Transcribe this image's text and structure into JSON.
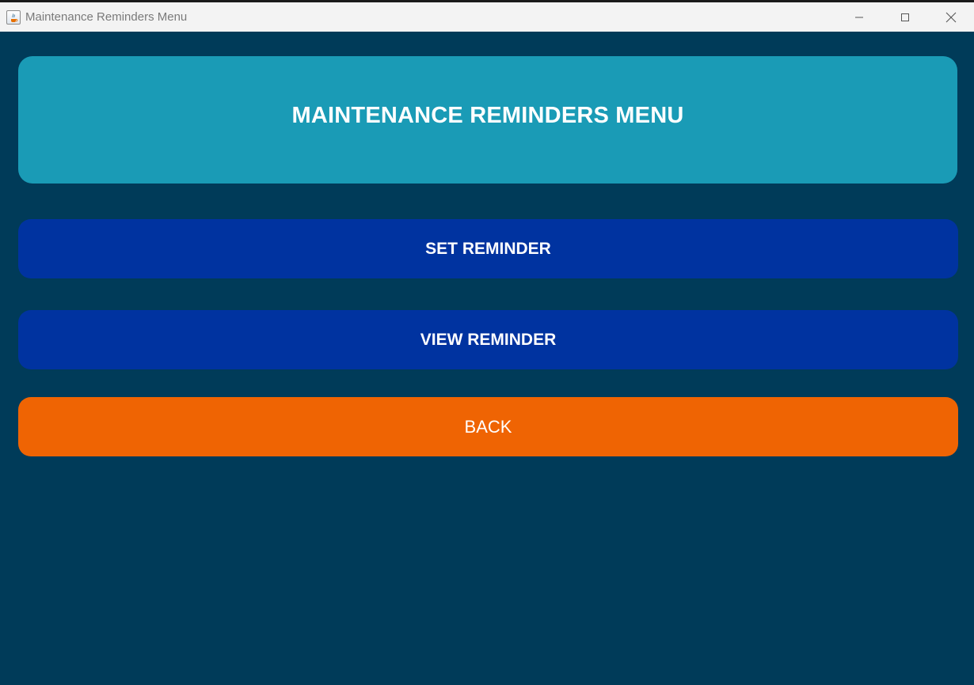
{
  "window": {
    "title": "Maintenance Reminders Menu",
    "app_icon": "java-icon",
    "controls": [
      "minimize-icon",
      "maximize-icon",
      "close-icon"
    ]
  },
  "header": {
    "title": "MAINTENANCE REMINDERS MENU"
  },
  "menu": {
    "set_reminder": "SET REMINDER",
    "view_reminder": "VIEW REMINDER",
    "back": "BACK"
  },
  "colors": {
    "background": "#003b59",
    "header_panel": "#1a9bb6",
    "primary_button": "#0033a0",
    "back_button": "#ef6403",
    "text": "#ffffff"
  }
}
